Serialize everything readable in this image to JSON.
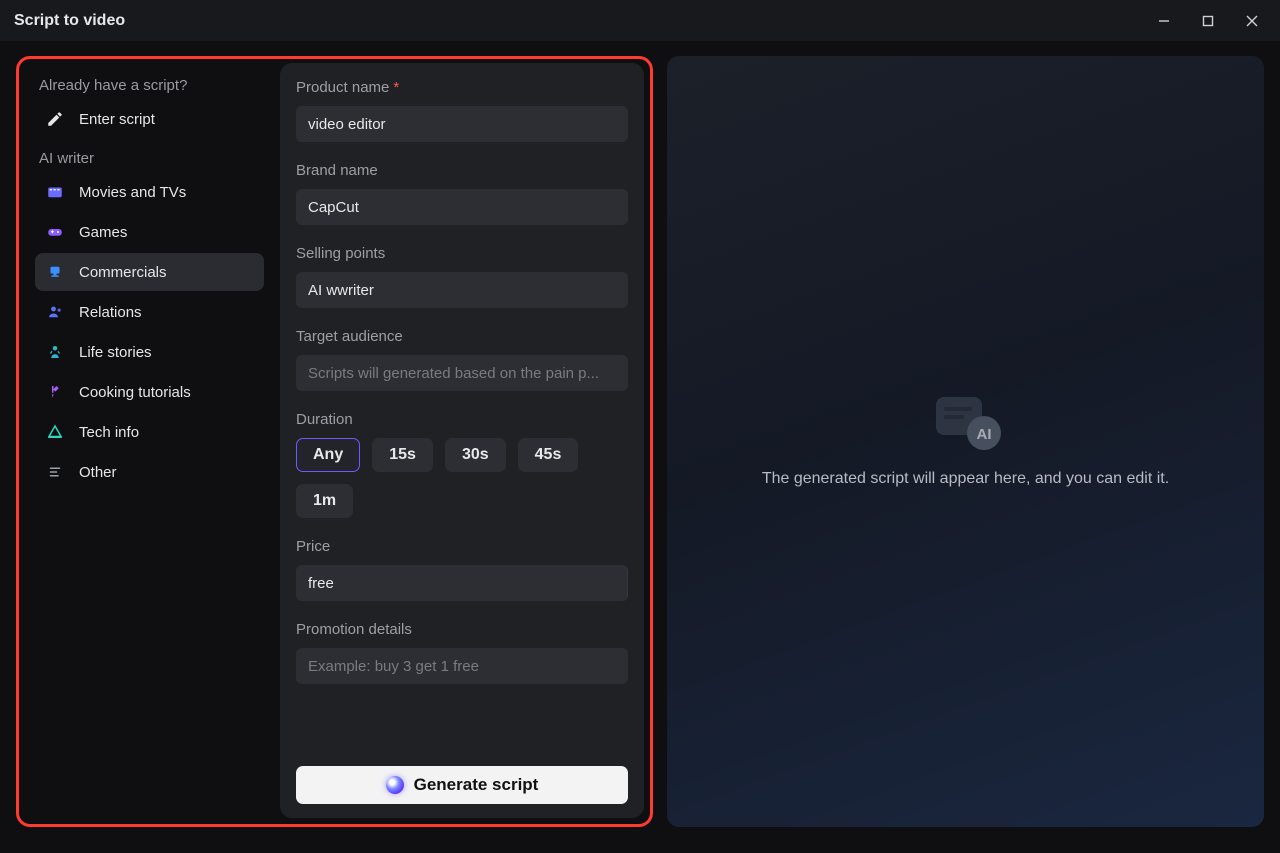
{
  "window": {
    "title": "Script to video"
  },
  "sidebar": {
    "section_script": "Already have a script?",
    "enter_script": "Enter script",
    "section_ai": "AI writer",
    "items": [
      {
        "label": "Movies and TVs",
        "name": "movies-and-tvs"
      },
      {
        "label": "Games",
        "name": "games"
      },
      {
        "label": "Commercials",
        "name": "commercials"
      },
      {
        "label": "Relations",
        "name": "relations"
      },
      {
        "label": "Life stories",
        "name": "life-stories"
      },
      {
        "label": "Cooking tutorials",
        "name": "cooking-tutorials"
      },
      {
        "label": "Tech info",
        "name": "tech-info"
      },
      {
        "label": "Other",
        "name": "other"
      }
    ],
    "active_index": 2
  },
  "form": {
    "product_name_label": "Product name",
    "product_name_value": "video editor",
    "brand_name_label": "Brand name",
    "brand_name_value": "CapCut",
    "selling_points_label": "Selling points",
    "selling_points_value": "AI wwriter",
    "target_audience_label": "Target audience",
    "target_audience_value": "",
    "target_audience_placeholder": "Scripts will generated based on the pain p...",
    "duration_label": "Duration",
    "duration_options": [
      "Any",
      "15s",
      "30s",
      "45s",
      "1m"
    ],
    "duration_selected": "Any",
    "price_label": "Price",
    "price_value": "free",
    "promotion_label": "Promotion details",
    "promotion_value": "",
    "promotion_placeholder": "Example: buy 3 get 1 free",
    "generate_label": "Generate script"
  },
  "preview": {
    "placeholder_text": "The generated script will appear here, and you can edit it."
  }
}
